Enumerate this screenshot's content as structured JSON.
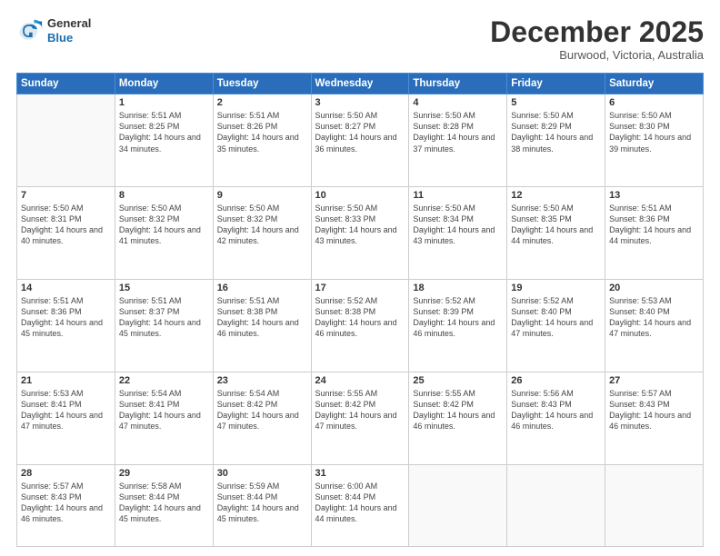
{
  "logo": {
    "line1": "General",
    "line2": "Blue"
  },
  "header": {
    "title": "December 2025",
    "location": "Burwood, Victoria, Australia"
  },
  "days_of_week": [
    "Sunday",
    "Monday",
    "Tuesday",
    "Wednesday",
    "Thursday",
    "Friday",
    "Saturday"
  ],
  "weeks": [
    [
      {
        "day": "",
        "info": ""
      },
      {
        "day": "1",
        "info": "Sunrise: 5:51 AM\nSunset: 8:25 PM\nDaylight: 14 hours\nand 34 minutes."
      },
      {
        "day": "2",
        "info": "Sunrise: 5:51 AM\nSunset: 8:26 PM\nDaylight: 14 hours\nand 35 minutes."
      },
      {
        "day": "3",
        "info": "Sunrise: 5:50 AM\nSunset: 8:27 PM\nDaylight: 14 hours\nand 36 minutes."
      },
      {
        "day": "4",
        "info": "Sunrise: 5:50 AM\nSunset: 8:28 PM\nDaylight: 14 hours\nand 37 minutes."
      },
      {
        "day": "5",
        "info": "Sunrise: 5:50 AM\nSunset: 8:29 PM\nDaylight: 14 hours\nand 38 minutes."
      },
      {
        "day": "6",
        "info": "Sunrise: 5:50 AM\nSunset: 8:30 PM\nDaylight: 14 hours\nand 39 minutes."
      }
    ],
    [
      {
        "day": "7",
        "info": "Sunrise: 5:50 AM\nSunset: 8:31 PM\nDaylight: 14 hours\nand 40 minutes."
      },
      {
        "day": "8",
        "info": "Sunrise: 5:50 AM\nSunset: 8:32 PM\nDaylight: 14 hours\nand 41 minutes."
      },
      {
        "day": "9",
        "info": "Sunrise: 5:50 AM\nSunset: 8:32 PM\nDaylight: 14 hours\nand 42 minutes."
      },
      {
        "day": "10",
        "info": "Sunrise: 5:50 AM\nSunset: 8:33 PM\nDaylight: 14 hours\nand 43 minutes."
      },
      {
        "day": "11",
        "info": "Sunrise: 5:50 AM\nSunset: 8:34 PM\nDaylight: 14 hours\nand 43 minutes."
      },
      {
        "day": "12",
        "info": "Sunrise: 5:50 AM\nSunset: 8:35 PM\nDaylight: 14 hours\nand 44 minutes."
      },
      {
        "day": "13",
        "info": "Sunrise: 5:51 AM\nSunset: 8:36 PM\nDaylight: 14 hours\nand 44 minutes."
      }
    ],
    [
      {
        "day": "14",
        "info": "Sunrise: 5:51 AM\nSunset: 8:36 PM\nDaylight: 14 hours\nand 45 minutes."
      },
      {
        "day": "15",
        "info": "Sunrise: 5:51 AM\nSunset: 8:37 PM\nDaylight: 14 hours\nand 45 minutes."
      },
      {
        "day": "16",
        "info": "Sunrise: 5:51 AM\nSunset: 8:38 PM\nDaylight: 14 hours\nand 46 minutes."
      },
      {
        "day": "17",
        "info": "Sunrise: 5:52 AM\nSunset: 8:38 PM\nDaylight: 14 hours\nand 46 minutes."
      },
      {
        "day": "18",
        "info": "Sunrise: 5:52 AM\nSunset: 8:39 PM\nDaylight: 14 hours\nand 46 minutes."
      },
      {
        "day": "19",
        "info": "Sunrise: 5:52 AM\nSunset: 8:40 PM\nDaylight: 14 hours\nand 47 minutes."
      },
      {
        "day": "20",
        "info": "Sunrise: 5:53 AM\nSunset: 8:40 PM\nDaylight: 14 hours\nand 47 minutes."
      }
    ],
    [
      {
        "day": "21",
        "info": "Sunrise: 5:53 AM\nSunset: 8:41 PM\nDaylight: 14 hours\nand 47 minutes."
      },
      {
        "day": "22",
        "info": "Sunrise: 5:54 AM\nSunset: 8:41 PM\nDaylight: 14 hours\nand 47 minutes."
      },
      {
        "day": "23",
        "info": "Sunrise: 5:54 AM\nSunset: 8:42 PM\nDaylight: 14 hours\nand 47 minutes."
      },
      {
        "day": "24",
        "info": "Sunrise: 5:55 AM\nSunset: 8:42 PM\nDaylight: 14 hours\nand 47 minutes."
      },
      {
        "day": "25",
        "info": "Sunrise: 5:55 AM\nSunset: 8:42 PM\nDaylight: 14 hours\nand 46 minutes."
      },
      {
        "day": "26",
        "info": "Sunrise: 5:56 AM\nSunset: 8:43 PM\nDaylight: 14 hours\nand 46 minutes."
      },
      {
        "day": "27",
        "info": "Sunrise: 5:57 AM\nSunset: 8:43 PM\nDaylight: 14 hours\nand 46 minutes."
      }
    ],
    [
      {
        "day": "28",
        "info": "Sunrise: 5:57 AM\nSunset: 8:43 PM\nDaylight: 14 hours\nand 46 minutes."
      },
      {
        "day": "29",
        "info": "Sunrise: 5:58 AM\nSunset: 8:44 PM\nDaylight: 14 hours\nand 45 minutes."
      },
      {
        "day": "30",
        "info": "Sunrise: 5:59 AM\nSunset: 8:44 PM\nDaylight: 14 hours\nand 45 minutes."
      },
      {
        "day": "31",
        "info": "Sunrise: 6:00 AM\nSunset: 8:44 PM\nDaylight: 14 hours\nand 44 minutes."
      },
      {
        "day": "",
        "info": ""
      },
      {
        "day": "",
        "info": ""
      },
      {
        "day": "",
        "info": ""
      }
    ]
  ]
}
